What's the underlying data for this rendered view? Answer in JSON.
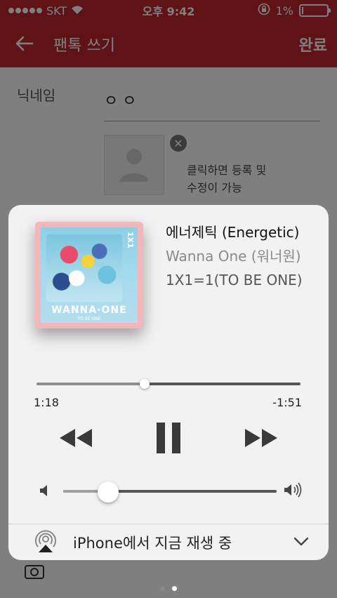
{
  "status_bar": {
    "carrier": "SKT",
    "time": "오후 9:42",
    "battery": "1%",
    "battery_level": 0.01
  },
  "nav": {
    "title": "팬톡 쓰기",
    "done": "완료"
  },
  "form": {
    "nickname_label": "닉네임",
    "nickname_value": "ㅇㅇ",
    "photo_hint_line1": "클릭하면 등록 및",
    "photo_hint_line2": "수정이 가능"
  },
  "now_playing": {
    "album_logo": "WANNA·ONE",
    "album_logo_sub": "TO BE ONE",
    "album_side": "1X1",
    "song": "에너제틱 (Energetic)",
    "artist": "Wanna One (워너원)",
    "album": "1X1=1(TO BE ONE)",
    "elapsed": "1:18",
    "remaining": "-1:51",
    "progress": 0.41,
    "volume": 0.21,
    "output": "iPhone에서 지금 재생 중"
  },
  "page_indicator": {
    "count": 2,
    "current": 2
  }
}
